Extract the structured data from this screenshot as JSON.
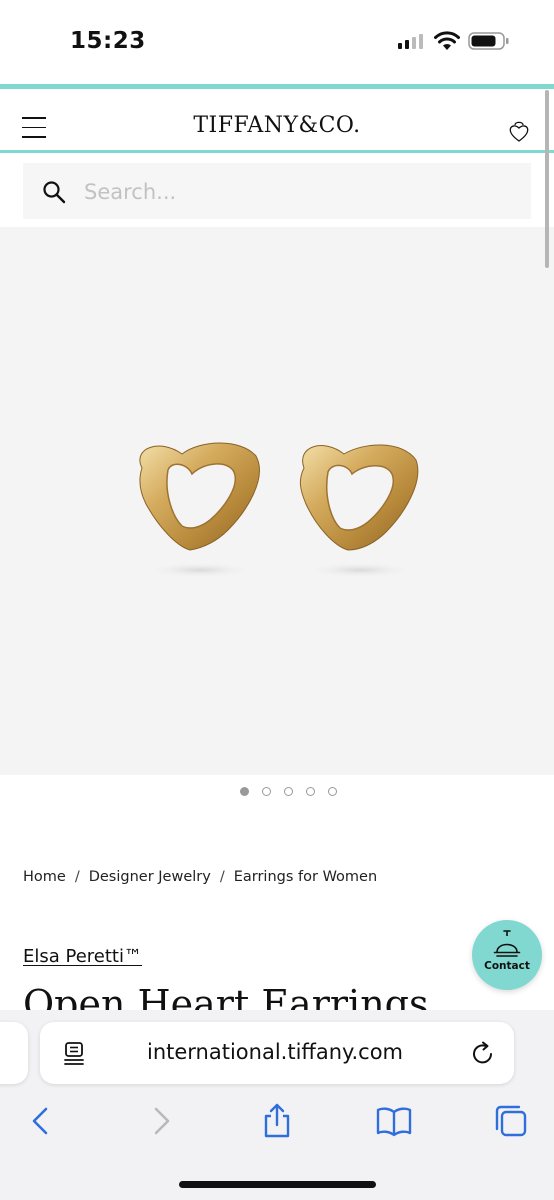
{
  "status_bar": {
    "time": "15:23"
  },
  "header": {
    "logo": "TIFFANY&CO.",
    "accent_color": "#81d8d0"
  },
  "search": {
    "placeholder": "Search..."
  },
  "product_image": {
    "carousel_total": 5,
    "carousel_active": 1
  },
  "breadcrumb": {
    "items": [
      "Home",
      "Designer Jewelry",
      "Earrings for Women"
    ],
    "separator": "/"
  },
  "product": {
    "designer": "Elsa Peretti™",
    "title": "Open Heart Earrings"
  },
  "contact": {
    "label": "Contact"
  },
  "browser": {
    "url": "international.tiffany.com"
  },
  "icons": {
    "menu": "hamburger-icon",
    "bag": "heart-bag-icon",
    "search": "search-icon",
    "contact": "service-bell-icon",
    "reader": "reader-mode-icon",
    "reload": "reload-icon",
    "back": "chevron-left-icon",
    "forward": "chevron-right-icon",
    "share": "share-icon",
    "bookmarks": "book-icon",
    "tabs": "tabs-icon"
  }
}
